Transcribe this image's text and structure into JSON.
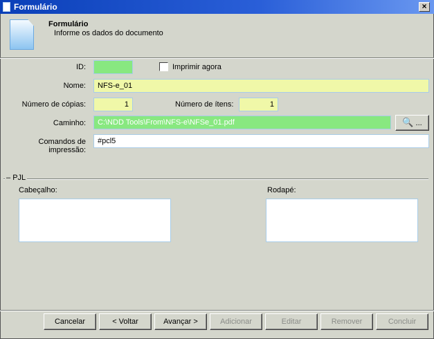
{
  "window": {
    "title": "Formulário",
    "close": "×"
  },
  "header": {
    "title": "Formulário",
    "subtitle": "Informe os dados do documento"
  },
  "form": {
    "id_label": "ID:",
    "id_value": "",
    "print_now_label": "Imprimir agora",
    "print_now_checked": false,
    "name_label": "Nome:",
    "name_value": "NFS-e_01",
    "copies_label": "Número de cópias:",
    "copies_value": "1",
    "items_label": "Número de ítens:",
    "items_value": "1",
    "path_label": "Caminho:",
    "path_value": "C:\\NDD Tools\\From\\NFS-e\\NFSe_01.pdf",
    "browse_label": "...",
    "commands_label": "Comandos de impressão:",
    "commands_value": "#pcl5"
  },
  "pjl": {
    "group_label": "PJL",
    "header_label": "Cabeçalho:",
    "header_value": "",
    "footer_label": "Rodapé:",
    "footer_value": ""
  },
  "buttons": {
    "cancel": "Cancelar",
    "back": "< Voltar",
    "next": "Avançar >",
    "add": "Adicionar",
    "edit": "Editar",
    "remove": "Remover",
    "finish": "Concluir"
  }
}
